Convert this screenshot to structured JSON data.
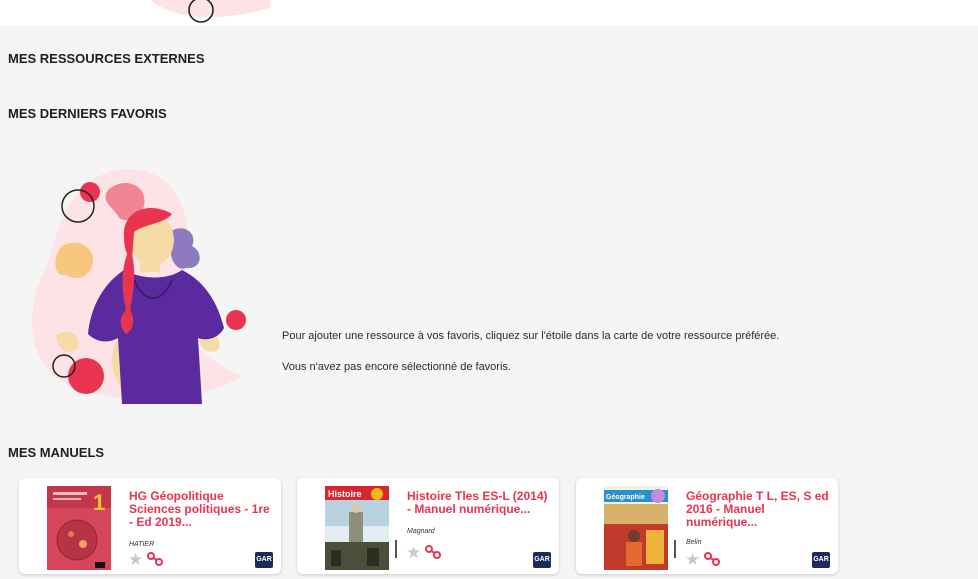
{
  "sections": {
    "external_title": "MES RESSOURCES EXTERNES",
    "favorites_title": "MES DERNIERS FAVORIS",
    "manuals_title": "MES MANUELS"
  },
  "favorites_empty": {
    "hint": "Pour ajouter une ressource à vos favoris, cliquez sur l'étoile dans la carte de votre ressource préférée.",
    "message": "Vous n'avez pas encore sélectionné de favoris."
  },
  "manuals": [
    {
      "title": "HG Géopolitique Sciences politiques - 1re - Ed 2019...",
      "publisher": "HATIER",
      "badge": "GAR",
      "cover_text": "1"
    },
    {
      "title": "Histoire Tles ES-L (2014) - Manuel numérique...",
      "publisher": "Magnard",
      "badge": "GAR",
      "cover_text": "Histoire"
    },
    {
      "title": "Géographie T L, ES, S ed 2016 - Manuel numérique...",
      "publisher": "Belin",
      "badge": "GAR",
      "cover_text": "Géographie"
    }
  ],
  "colors": {
    "accent": "#e8344e",
    "gar_badge": "#1d2a5c",
    "star_inactive": "#c9c9c9",
    "background": "#f5f5f5"
  },
  "icons": {
    "favorite": "star-icon",
    "link": "link-icon",
    "badge": "gar-badge"
  }
}
